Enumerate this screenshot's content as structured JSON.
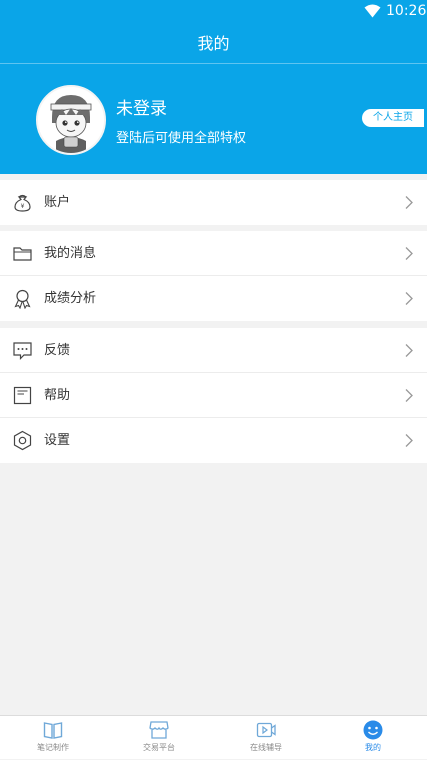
{
  "status_bar": {
    "time": "10:26",
    "wifi_icon": "wifi-icon"
  },
  "header": {
    "title": "我的"
  },
  "profile": {
    "name": "未登录",
    "hint": "登陆后可使用全部特权",
    "homepage_button": "个人主页",
    "avatar_icon": "cartoon-avatar"
  },
  "menu_groups": [
    [
      {
        "label": "账户",
        "icon": "money-bag-icon"
      }
    ],
    [
      {
        "label": "我的消息",
        "icon": "folder-icon"
      },
      {
        "label": "成绩分析",
        "icon": "award-ribbon-icon"
      }
    ],
    [
      {
        "label": "反馈",
        "icon": "chat-bubble-icon"
      },
      {
        "label": "帮助",
        "icon": "document-icon"
      },
      {
        "label": "设置",
        "icon": "settings-gear-icon"
      }
    ]
  ],
  "tabbar": {
    "tabs": [
      {
        "label": "笔记制作",
        "icon": "book-icon"
      },
      {
        "label": "交易平台",
        "icon": "shop-icon"
      },
      {
        "label": "在线辅导",
        "icon": "video-icon"
      },
      {
        "label": "我的",
        "icon": "smiley-icon",
        "active": true
      }
    ]
  },
  "colors": {
    "primary": "#0aa5e8",
    "background": "#f2f2f2",
    "tab_active": "#2a8be8",
    "tab_inactive": "#6fa8d8"
  }
}
